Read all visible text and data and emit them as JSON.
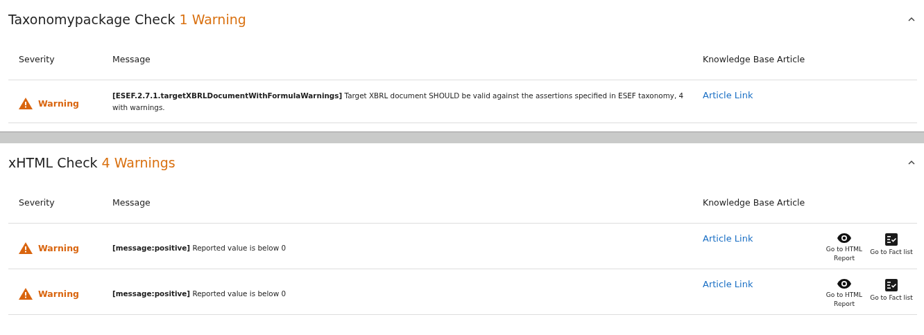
{
  "sections": [
    {
      "title": "Taxonomypackage Check",
      "count": "1 Warning",
      "expanded": true,
      "columns": [
        "Severity",
        "Message",
        "Knowledge Base Article"
      ],
      "rows": [
        {
          "severity": {
            "kind": "warning",
            "label": "Warning"
          },
          "message": "**[ESEF.2.7.1.targetXBRLDocumentWithFormulaWarnings]** Target XBRL document SHOULD be valid against the assertions specified in ESEF taxonomy, 4 with warnings.",
          "link": "Article Link"
        }
      ]
    },
    {
      "title": "xHTML Check",
      "count": "4 Warnings",
      "expanded": true,
      "columns": [
        "Severity",
        "Message",
        "Knowledge Base Article"
      ],
      "rows": [
        {
          "severity": {
            "kind": "warning",
            "label": "Warning"
          },
          "message": "**[message:positive]** Reported value is below 0",
          "link": "Article Link",
          "actions": [
            {
              "kind": "html_report",
              "label": "Go to HTML Report"
            },
            {
              "kind": "fact_list",
              "label": "Go to Fact list"
            }
          ]
        },
        {
          "severity": {
            "kind": "warning",
            "label": "Warning"
          },
          "message": "**[message:positive]** Reported value is below 0",
          "link": "Article Link",
          "actions": [
            {
              "kind": "html_report",
              "label": "Go to HTML Report"
            },
            {
              "kind": "fact_list",
              "label": "Go to Fact list"
            }
          ]
        }
      ]
    }
  ]
}
